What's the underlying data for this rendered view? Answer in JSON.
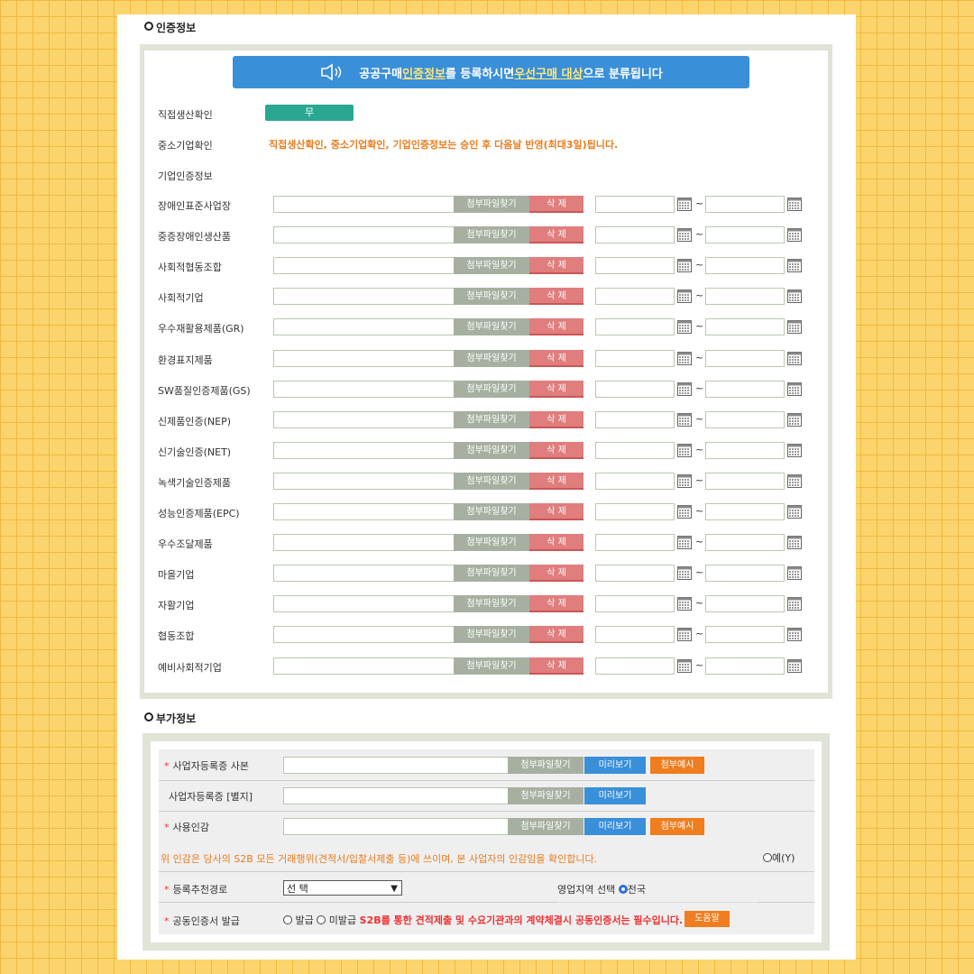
{
  "cert": {
    "title": "인증정보",
    "banner": {
      "p1": "공공구매 ",
      "h1": "인증정보",
      "p2": "를 등록하시면 ",
      "h2": "우선구매 대상",
      "p3": "으로 분류됩니다"
    },
    "direct_label": "직접생산확인",
    "direct_value": "무",
    "sme_label": "중소기업확인",
    "notice": "직접생산확인, 중소기업확인, 기업인증정보는 승인 후 다음날 반영(최대3일)됩니다.",
    "corp_label": "기업인증정보",
    "find_btn": "첨부파일찾기",
    "delete_btn": "삭  제",
    "tilde": "~",
    "items": [
      "장애인표준사업장",
      "중증장애인생산품",
      "사회적협동조합",
      "사회적기업",
      "우수재활용제품(GR)",
      "환경표지제품",
      "SW품질인증제품(GS)",
      "신제품인증(NEP)",
      "신기술인증(NET)",
      "녹색기술인증제품",
      "성능인증제품(EPC)",
      "우수조달제품",
      "마을기업",
      "자활기업",
      "협동조합",
      "예비사회적기업"
    ]
  },
  "extra": {
    "title": "부가정보",
    "star": "*",
    "biz_copy": "사업자등록증 사본",
    "biz_attach": "사업자등록증 [별지]",
    "seal": "사용인감",
    "find_btn": "첨부파일찾기",
    "preview_btn": "미리보기",
    "example_btn": "첨부예시",
    "seal_notice": "위 인감은 당사의 S2B 모든 거래행위(견적서/입찰서제출 등)에 쓰이며, 본 사업자의 인감임을 확인합니다.",
    "yes": "예(Y)",
    "route_label": "등록추천경로",
    "route_value": "선 택",
    "region_label": "영업지역 선택",
    "region_value": "전국",
    "cert_label": "공동인증서 발급",
    "issued": "발급",
    "not_issued": "미발급",
    "cert_notice": "S2B를 통한 견적제출 및 수요기관과의 계약체결시 공동인증서는 필수입니다.",
    "help_btn": "도움말"
  },
  "colors": {
    "banner": "#3a8fd9",
    "green": "#2aa792",
    "orange": "#f07d1e",
    "red_text": "#e33333"
  }
}
